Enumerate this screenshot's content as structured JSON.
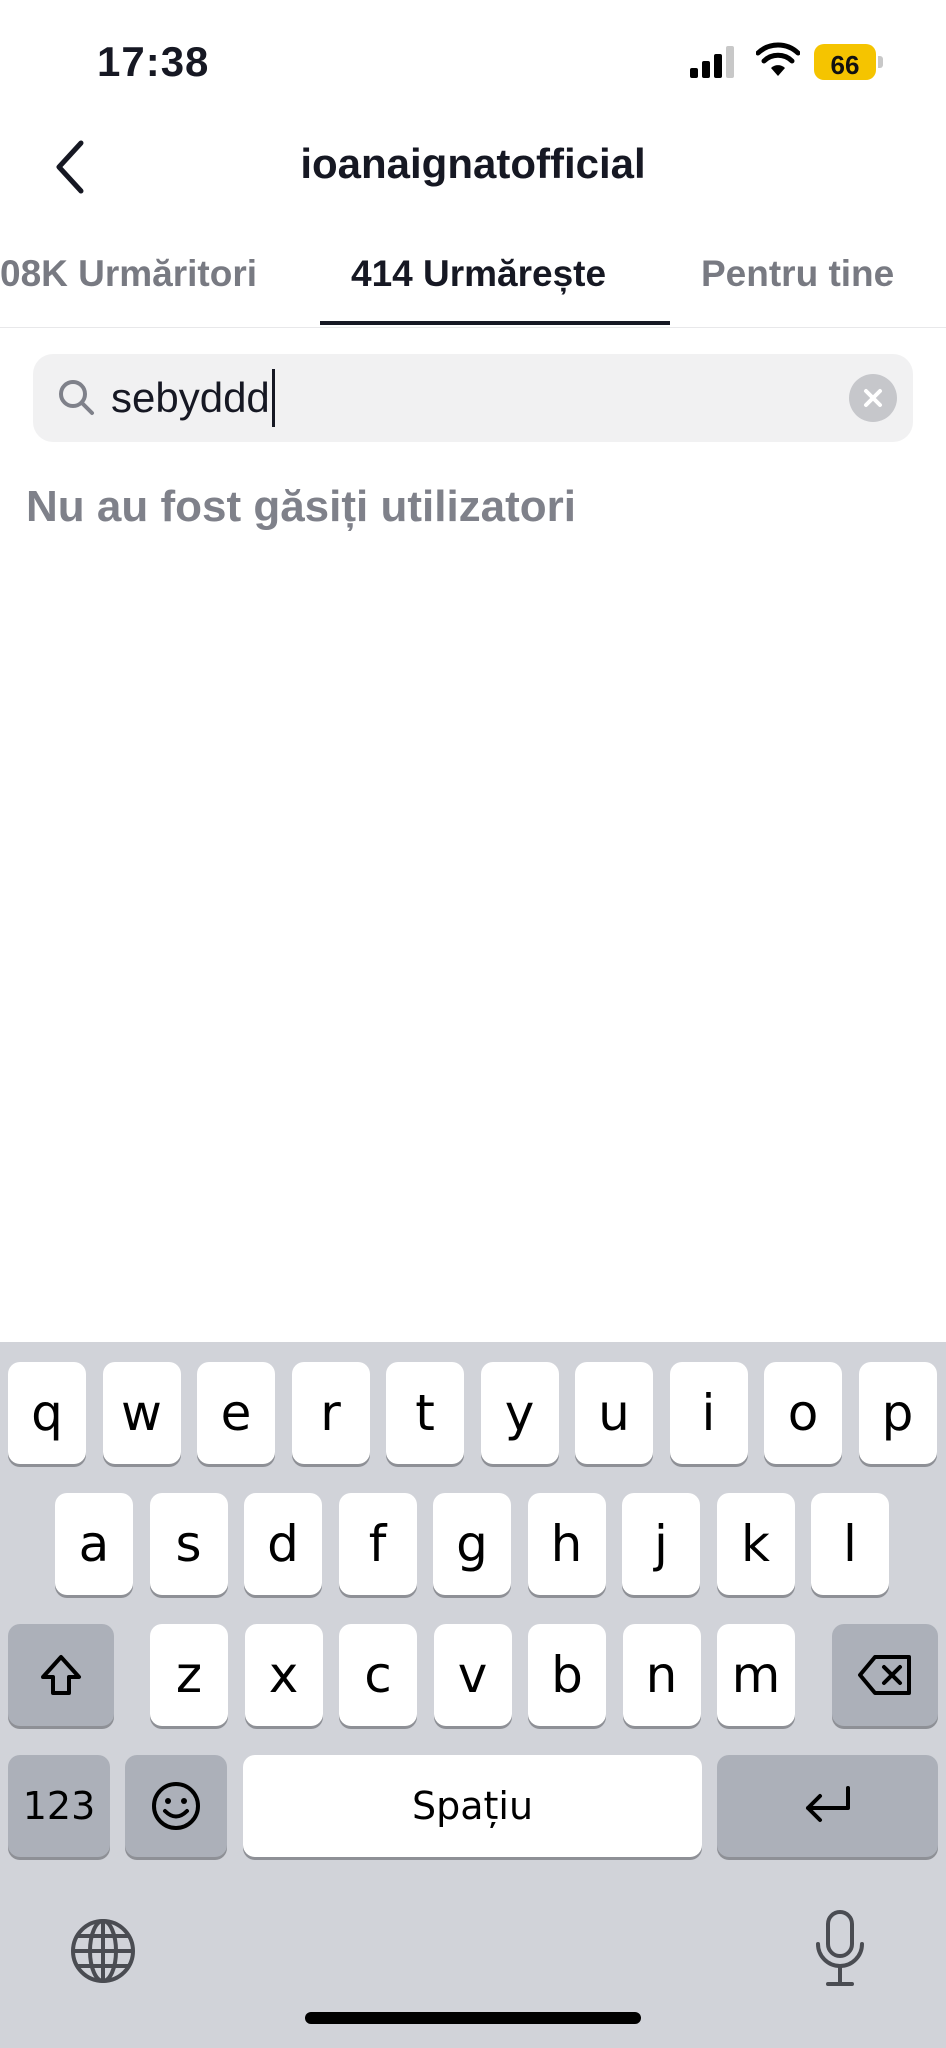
{
  "status_bar": {
    "time": "17:38",
    "battery_level": "66",
    "battery_color": "#f5c400"
  },
  "header": {
    "title": "ioanaignatofficial",
    "back_icon": "chevron-left-icon"
  },
  "tabs": [
    {
      "label": "08K Urmăritori",
      "active": false
    },
    {
      "label": "414 Urmărește",
      "active": true
    },
    {
      "label": "Pentru tine",
      "active": false
    }
  ],
  "search": {
    "value": "sebyddd",
    "search_icon": "search-icon",
    "clear_icon": "clear-icon"
  },
  "empty_message": "Nu au fost găsiți utilizatori",
  "keyboard": {
    "row1": [
      "q",
      "w",
      "e",
      "r",
      "t",
      "y",
      "u",
      "i",
      "o",
      "p"
    ],
    "row2": [
      "a",
      "s",
      "d",
      "f",
      "g",
      "h",
      "j",
      "k",
      "l"
    ],
    "row3": [
      "z",
      "x",
      "c",
      "v",
      "b",
      "n",
      "m"
    ],
    "numbers_label": "123",
    "space_label": "Spațiu"
  }
}
